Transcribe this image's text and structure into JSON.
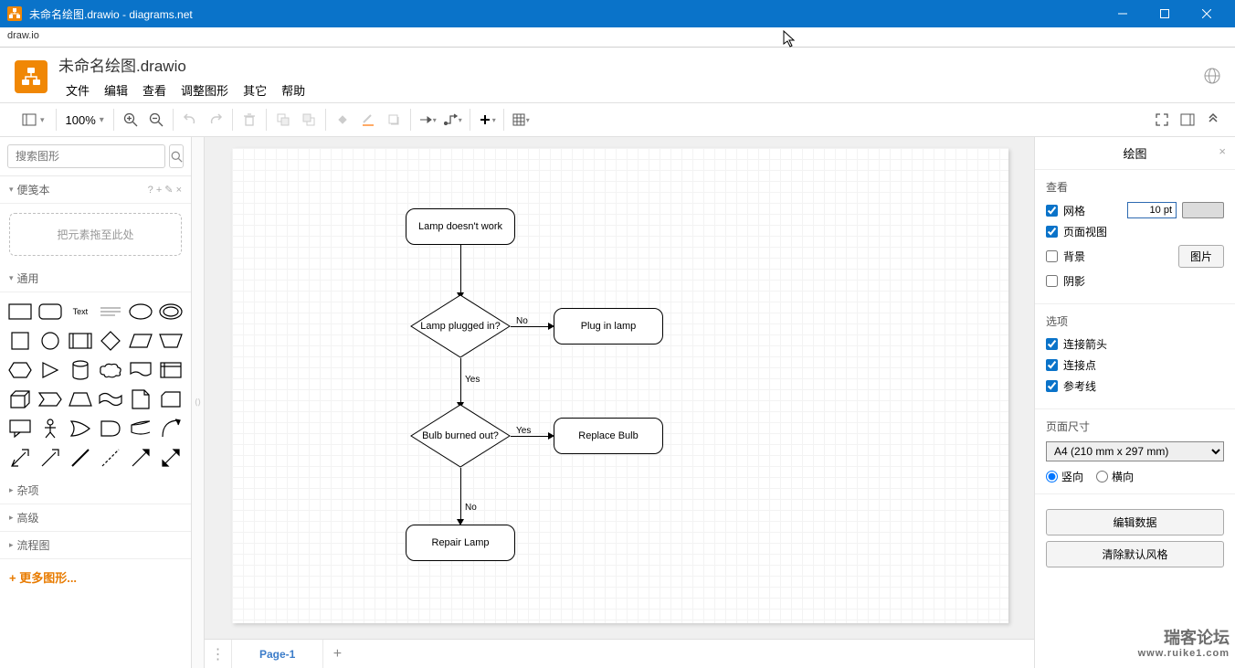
{
  "titlebar": {
    "title": "未命名绘图.drawio - diagrams.net"
  },
  "subtitle": "draw.io",
  "document_name": "未命名绘图.drawio",
  "menu": [
    "文件",
    "编辑",
    "查看",
    "调整图形",
    "其它",
    "帮助"
  ],
  "zoom": "100%",
  "search_placeholder": "搜索图形",
  "left": {
    "scratchpad_title": "便笺本",
    "scratchpad_hint": "? + ✎ ×",
    "drop_hint": "把元素拖至此处",
    "sections": {
      "general": "通用",
      "misc": "杂项",
      "advanced": "高级",
      "flowchart": "流程图"
    },
    "more_shapes": "+ 更多图形..."
  },
  "flowchart": {
    "n1": "Lamp doesn't work",
    "d1": "Lamp plugged in?",
    "r1": "Plug in lamp",
    "d2": "Bulb burned out?",
    "r2": "Replace Bulb",
    "n2": "Repair Lamp",
    "no": "No",
    "yes": "Yes"
  },
  "pages": {
    "tab1": "Page-1"
  },
  "right": {
    "title": "绘图",
    "view": "查看",
    "grid": "网格",
    "grid_val": "10 pt",
    "pageview": "页面视图",
    "background": "背景",
    "image_btn": "图片",
    "shadow": "阴影",
    "options": "选项",
    "conn_arrows": "连接箭头",
    "conn_points": "连接点",
    "guides": "参考线",
    "page_size": "页面尺寸",
    "page_size_val": "A4 (210 mm x 297 mm)",
    "portrait": "竖向",
    "landscape": "横向",
    "edit_data": "编辑数据",
    "clear_style": "清除默认风格"
  },
  "watermark": {
    "line1": "瑞客论坛",
    "line2": "www.ruike1.com"
  }
}
